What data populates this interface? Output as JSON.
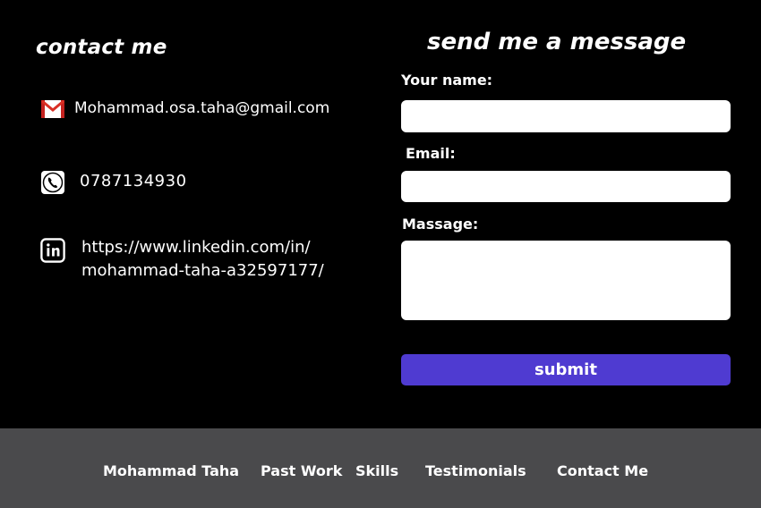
{
  "contact": {
    "title": "contact me",
    "email": "Mohammad.osa.taha@gmail.com",
    "phone": "0787134930",
    "linkedin_line1": "https://www.linkedin.com/in/",
    "linkedin_line2": "mohammad-taha-a32597177/",
    "icons": [
      "gmail-icon",
      "phone-icon",
      "linkedin-icon"
    ]
  },
  "form": {
    "title": "send me a message",
    "name_label": "Your name:",
    "name_value": "",
    "email_label": "Email:",
    "email_value": "",
    "message_label": "Massage:",
    "message_value": "",
    "submit_label": "submit"
  },
  "footer": {
    "nav": [
      "Mohammad Taha",
      "Past Work",
      "Skills",
      "Testimonials",
      "Contact Me"
    ]
  },
  "colors": {
    "background": "#000000",
    "footer": "#4a4a4c",
    "submit": "#4f3bd1",
    "field": "#ffffff"
  }
}
